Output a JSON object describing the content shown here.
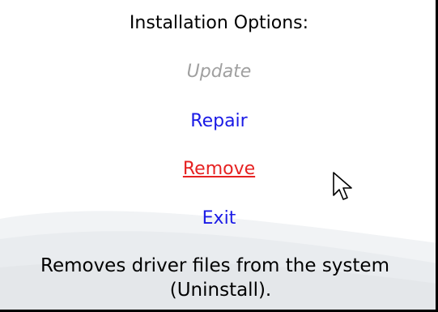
{
  "heading": "Installation Options:",
  "options": {
    "update": "Update",
    "repair": "Repair",
    "remove": "Remove",
    "exit": "Exit"
  },
  "description": {
    "line1": "Removes driver files from the system",
    "line2": "(Uninstall)."
  },
  "colors": {
    "link": "#1a1ae6",
    "hover": "#e62222",
    "disabled": "#a0a0a0",
    "text": "#000000"
  },
  "icons": {
    "pointer": "mouse-pointer-icon"
  }
}
